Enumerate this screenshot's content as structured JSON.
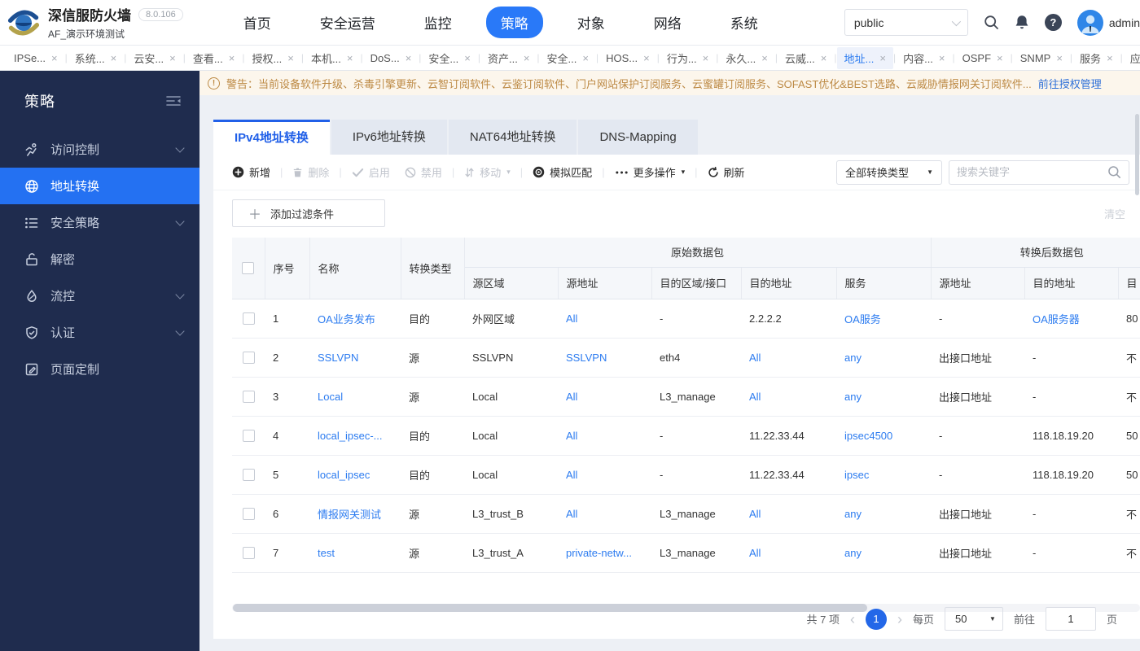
{
  "header": {
    "title": "深信服防火墙",
    "version": "8.0.106",
    "subtitle": "AF_演示环境测试",
    "nav": [
      {
        "label": "首页"
      },
      {
        "label": "安全运营"
      },
      {
        "label": "监控"
      },
      {
        "label": "策略",
        "active": true
      },
      {
        "label": "对象"
      },
      {
        "label": "网络"
      },
      {
        "label": "系统"
      }
    ],
    "scope_select": "public",
    "user": "admin"
  },
  "tabstrip": {
    "tabs": [
      {
        "label": "IPSe..."
      },
      {
        "label": "系统..."
      },
      {
        "label": "云安..."
      },
      {
        "label": "查看..."
      },
      {
        "label": "授权..."
      },
      {
        "label": "本机..."
      },
      {
        "label": "DoS..."
      },
      {
        "label": "安全..."
      },
      {
        "label": "资产..."
      },
      {
        "label": "安全..."
      },
      {
        "label": "HOS..."
      },
      {
        "label": "行为..."
      },
      {
        "label": "永久..."
      },
      {
        "label": "云威..."
      },
      {
        "label": "地址...",
        "active": true
      },
      {
        "label": "内容..."
      },
      {
        "label": "OSPF"
      },
      {
        "label": "SNMP"
      },
      {
        "label": "服务"
      },
      {
        "label": "应用..."
      }
    ]
  },
  "warning": {
    "text": "警告：当前设备软件升级、杀毒引擎更新、云智订阅软件、云鉴订阅软件、门户网站保护订阅服务、云蜜罐订阅服务、SOFAST优化&BEST选路、云威胁情报网关订阅软件...",
    "link": "前往授权管理"
  },
  "sidebar": {
    "title": "策略",
    "items": [
      {
        "label": "访问控制",
        "icon": "access-control-icon",
        "expandable": true
      },
      {
        "label": "地址转换",
        "icon": "nat-icon",
        "active": true
      },
      {
        "label": "安全策略",
        "icon": "security-policy-icon",
        "expandable": true
      },
      {
        "label": "解密",
        "icon": "decrypt-icon"
      },
      {
        "label": "流控",
        "icon": "flow-control-icon",
        "expandable": true
      },
      {
        "label": "认证",
        "icon": "auth-icon",
        "expandable": true
      },
      {
        "label": "页面定制",
        "icon": "page-custom-icon"
      }
    ]
  },
  "content": {
    "tabs": [
      {
        "label": "IPv4地址转换",
        "active": true
      },
      {
        "label": "IPv6地址转换"
      },
      {
        "label": "NAT64地址转换"
      },
      {
        "label": "DNS-Mapping"
      }
    ],
    "toolbar": {
      "buttons": [
        {
          "label": "新增",
          "icon": "add-icon",
          "sep": true
        },
        {
          "label": "删除",
          "icon": "delete-icon",
          "disabled": true,
          "sep": true
        },
        {
          "label": "启用",
          "icon": "enable-icon",
          "disabled": true
        },
        {
          "label": "禁用",
          "icon": "disable-icon",
          "disabled": true,
          "sep": true
        },
        {
          "label": "移动",
          "icon": "move-icon",
          "disabled": true,
          "dropdown": true,
          "sep": true
        },
        {
          "label": "模拟匹配",
          "icon": "simulate-icon",
          "sep": true
        },
        {
          "label": "更多操作",
          "icon": "more-icon",
          "dropdown": true,
          "sep": true
        },
        {
          "label": "刷新",
          "icon": "refresh-icon"
        }
      ],
      "type_filter": "全部转换类型",
      "search_placeholder": "搜索关键字"
    },
    "filter": {
      "add_label": "添加过滤条件",
      "clear_label": "清空"
    },
    "table": {
      "group_headers": {
        "original": "原始数据包",
        "translated": "转换后数据包"
      },
      "columns": [
        "序号",
        "名称",
        "转换类型",
        "源区域",
        "源地址",
        "目的区域/接口",
        "目的地址",
        "服务",
        "源地址",
        "目的地址",
        "目"
      ],
      "rows": [
        {
          "cells": [
            {
              "t": "1"
            },
            {
              "t": "OA业务发布",
              "link": true
            },
            {
              "t": "目的"
            },
            {
              "t": "外网区域"
            },
            {
              "t": "All",
              "link": true
            },
            {
              "t": "-"
            },
            {
              "t": "2.2.2.2"
            },
            {
              "t": "OA服务",
              "link": true
            },
            {
              "t": "-"
            },
            {
              "t": "OA服务器",
              "link": true
            },
            {
              "t": "80"
            }
          ]
        },
        {
          "cells": [
            {
              "t": "2"
            },
            {
              "t": "SSLVPN",
              "link": true
            },
            {
              "t": "源"
            },
            {
              "t": "SSLVPN"
            },
            {
              "t": "SSLVPN",
              "link": true
            },
            {
              "t": "eth4"
            },
            {
              "t": "All",
              "link": true
            },
            {
              "t": "any",
              "link": true
            },
            {
              "t": "出接口地址"
            },
            {
              "t": "-"
            },
            {
              "t": "不"
            }
          ]
        },
        {
          "cells": [
            {
              "t": "3"
            },
            {
              "t": "Local",
              "link": true
            },
            {
              "t": "源"
            },
            {
              "t": "Local"
            },
            {
              "t": "All",
              "link": true
            },
            {
              "t": "L3_manage"
            },
            {
              "t": "All",
              "link": true
            },
            {
              "t": "any",
              "link": true
            },
            {
              "t": "出接口地址"
            },
            {
              "t": "-"
            },
            {
              "t": "不"
            }
          ]
        },
        {
          "cells": [
            {
              "t": "4"
            },
            {
              "t": "local_ipsec-...",
              "link": true
            },
            {
              "t": "目的"
            },
            {
              "t": "Local"
            },
            {
              "t": "All",
              "link": true
            },
            {
              "t": "-"
            },
            {
              "t": "11.22.33.44"
            },
            {
              "t": "ipsec4500",
              "link": true
            },
            {
              "t": "-"
            },
            {
              "t": "118.18.19.20"
            },
            {
              "t": "50"
            }
          ]
        },
        {
          "cells": [
            {
              "t": "5"
            },
            {
              "t": "local_ipsec",
              "link": true
            },
            {
              "t": "目的"
            },
            {
              "t": "Local"
            },
            {
              "t": "All",
              "link": true
            },
            {
              "t": "-"
            },
            {
              "t": "11.22.33.44"
            },
            {
              "t": "ipsec",
              "link": true
            },
            {
              "t": "-"
            },
            {
              "t": "118.18.19.20"
            },
            {
              "t": "50"
            }
          ]
        },
        {
          "cells": [
            {
              "t": "6"
            },
            {
              "t": "情报网关测试",
              "link": true
            },
            {
              "t": "源"
            },
            {
              "t": "L3_trust_B"
            },
            {
              "t": "All",
              "link": true
            },
            {
              "t": "L3_manage"
            },
            {
              "t": "All",
              "link": true
            },
            {
              "t": "any",
              "link": true
            },
            {
              "t": "出接口地址"
            },
            {
              "t": "-"
            },
            {
              "t": "不"
            }
          ]
        },
        {
          "cells": [
            {
              "t": "7"
            },
            {
              "t": "test",
              "link": true
            },
            {
              "t": "源"
            },
            {
              "t": "L3_trust_A"
            },
            {
              "t": "private-netw...",
              "link": true
            },
            {
              "t": "L3_manage"
            },
            {
              "t": "All",
              "link": true
            },
            {
              "t": "any",
              "link": true
            },
            {
              "t": "出接口地址"
            },
            {
              "t": "-"
            },
            {
              "t": "不"
            }
          ]
        }
      ]
    },
    "pagination": {
      "total": "共 7 项",
      "current_page": "1",
      "per_page_label": "每页",
      "page_size": "50",
      "goto_label": "前往",
      "goto_value": "1",
      "page_label": "页"
    }
  }
}
